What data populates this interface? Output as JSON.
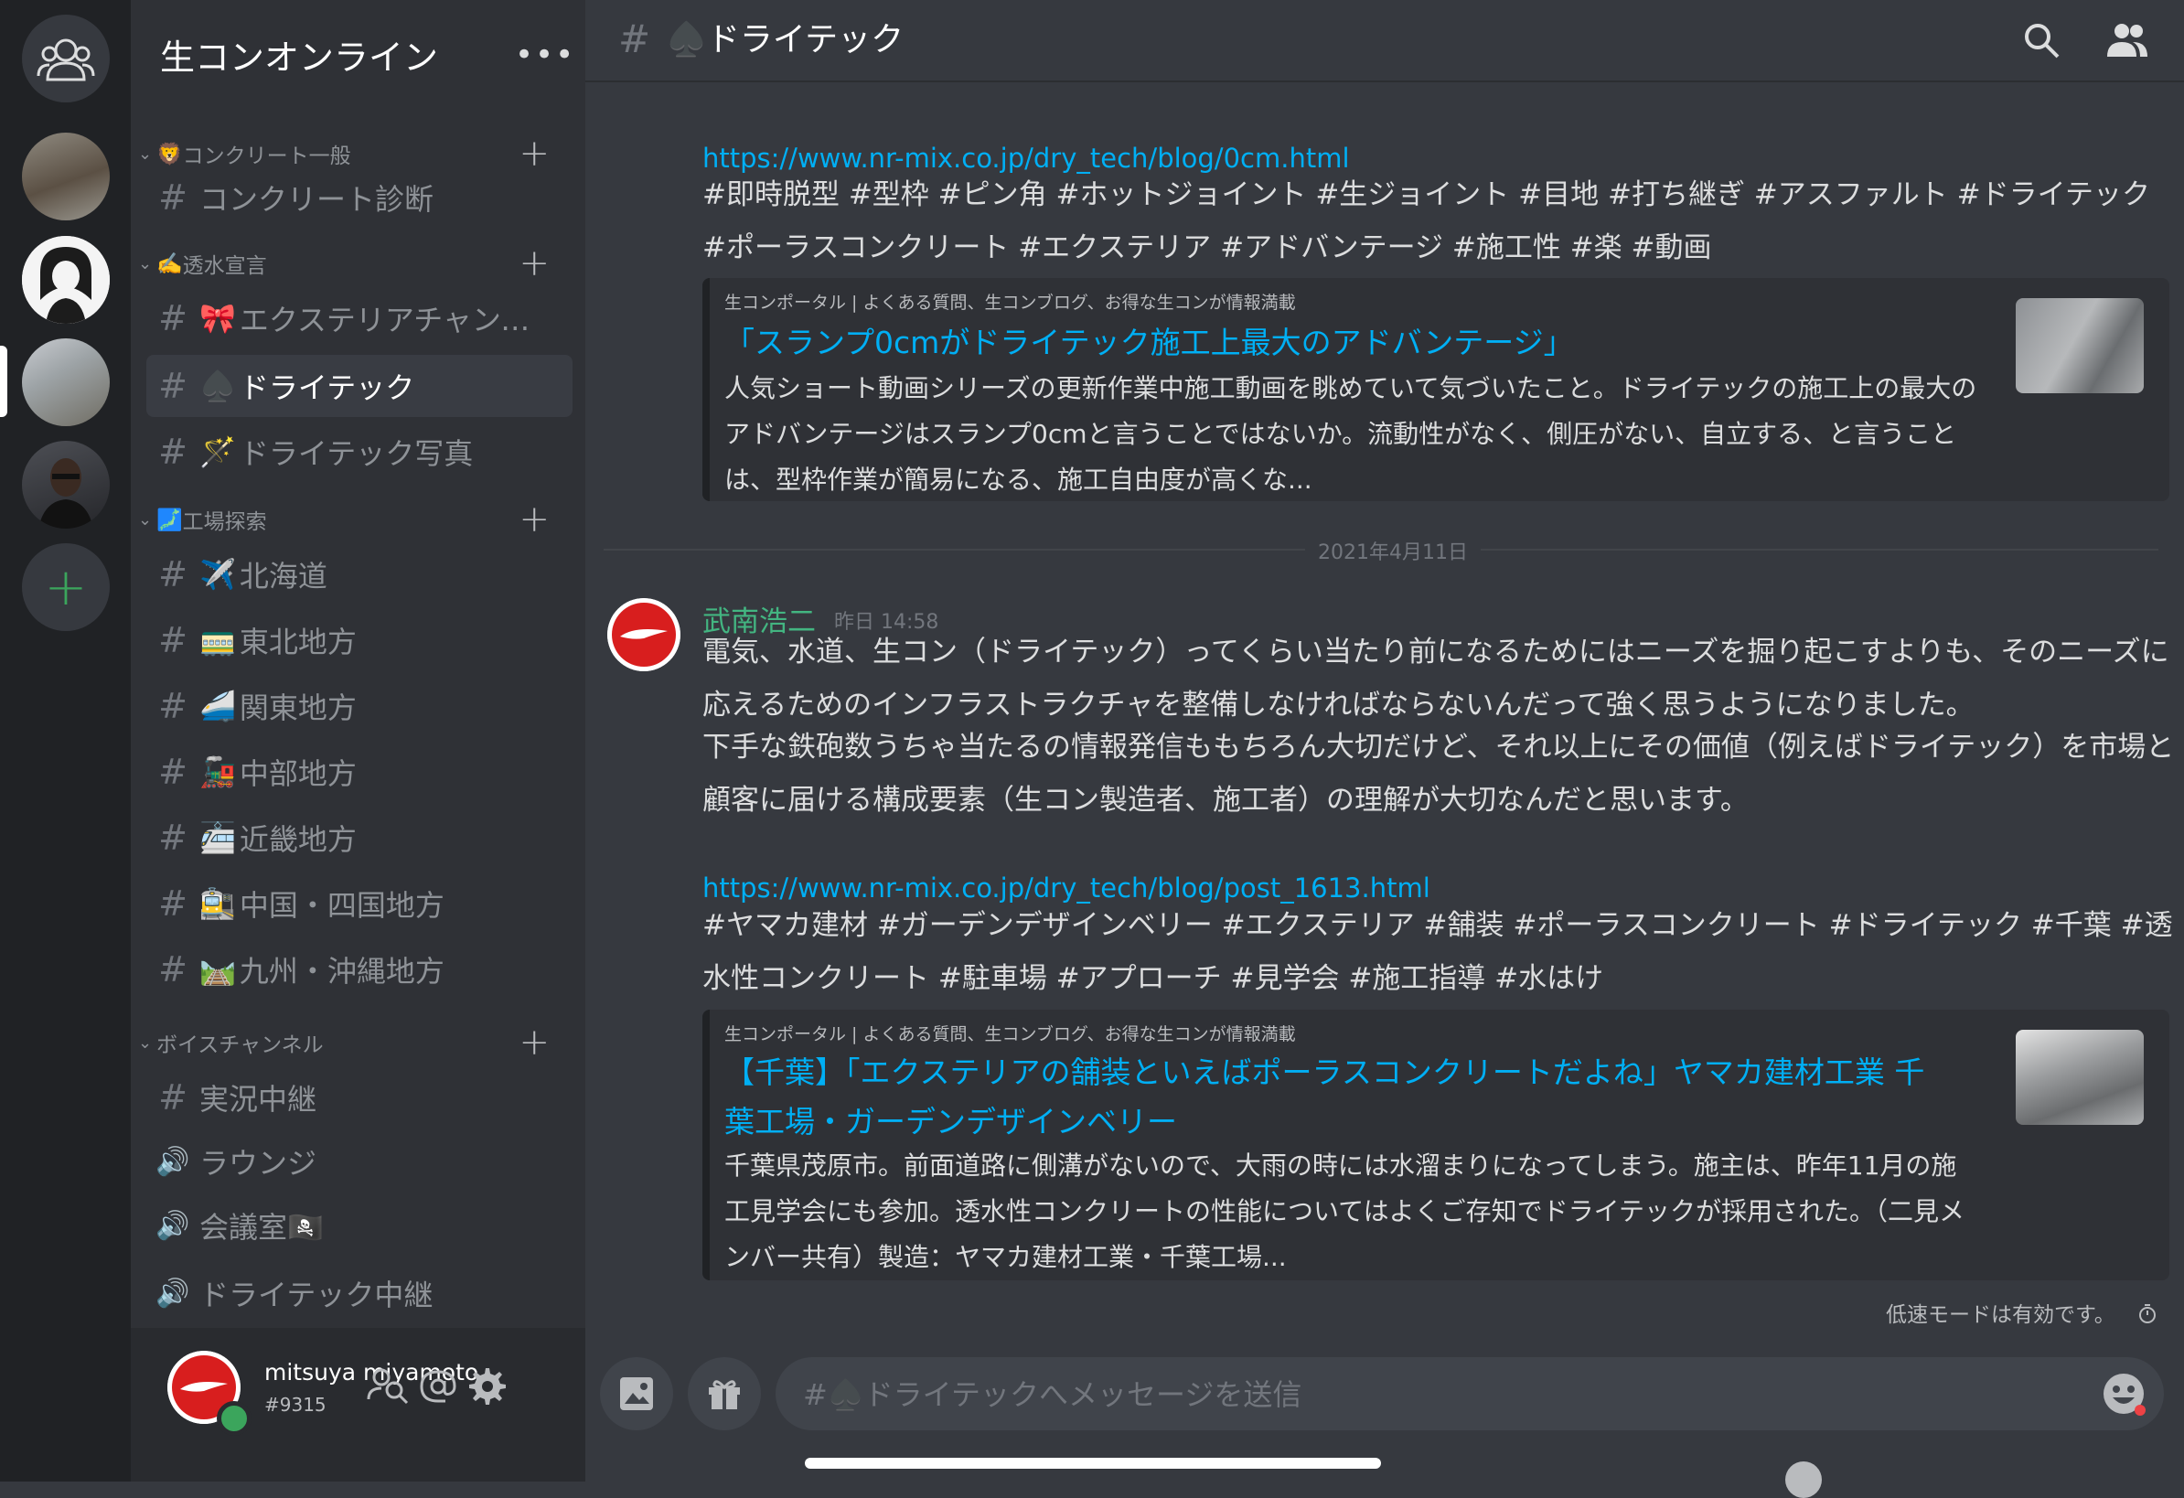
{
  "guild": {
    "name": "生コンオンライン",
    "more": "•••"
  },
  "categories": [
    {
      "emoji": "🦁",
      "name": "コンクリート一般"
    },
    {
      "emoji": "✍️",
      "name": "透水宣言"
    },
    {
      "emoji": "🗾",
      "name": "工場探索"
    },
    {
      "emoji": "",
      "name": "ボイスチャンネル"
    }
  ],
  "channels": [
    {
      "icon": "#",
      "emoji": "",
      "name": "コンクリート診断"
    },
    {
      "icon": "#",
      "emoji": "🎀",
      "name": "エクステリアチャンネル"
    },
    {
      "icon": "#",
      "emoji": "♠️",
      "name": "ドライテック"
    },
    {
      "icon": "#",
      "emoji": "🪄",
      "name": "ドライテック写真"
    },
    {
      "icon": "#",
      "emoji": "✈️",
      "name": "北海道"
    },
    {
      "icon": "#",
      "emoji": "🚃",
      "name": "東北地方"
    },
    {
      "icon": "#",
      "emoji": "🚄",
      "name": "関東地方"
    },
    {
      "icon": "#",
      "emoji": "🚂",
      "name": "中部地方"
    },
    {
      "icon": "#",
      "emoji": "🚈",
      "name": "近畿地方"
    },
    {
      "icon": "#",
      "emoji": "🚉",
      "name": "中国・四国地方"
    },
    {
      "icon": "#",
      "emoji": "🛤️",
      "name": "九州・沖縄地方"
    },
    {
      "icon": "#",
      "emoji": "",
      "name": "実況中継"
    },
    {
      "icon": "🔊",
      "emoji": "",
      "name": "ラウンジ"
    },
    {
      "icon": "🔊",
      "emoji": "",
      "name": "会議室🏴‍☠️"
    },
    {
      "icon": "🔊",
      "emoji": "",
      "name": "ドライテック中継"
    }
  ],
  "user": {
    "name": "mitsuya miyamoto",
    "tag": "#9315",
    "status_color": "#3ba55c"
  },
  "header": {
    "hash": "#",
    "title": "♠️ドライテック"
  },
  "messages": {
    "m1": {
      "link": "https://www.nr-mix.co.jp/dry_tech/blog/0cm.html",
      "text": "#即時脱型 #型枠 #ピン角 #ホットジョイント #生ジョイント #目地 #打ち継ぎ #アスファルト #ドライテック #ポーラスコンクリート #エクステリア #アドバンテージ #施工性 #楽 #動画",
      "embed": {
        "provider": "生コンポータル | よくある質問、生コンブログ、お得な生コンが情報満載",
        "title": "「スランプ0cmがドライテック施工上最大のアドバンテージ」",
        "desc": "人気ショート動画シリーズの更新作業中施工動画を眺めていて気づいたこと。ドライテックの施工上の最大のアドバンテージはスランプ0cmと言うことではないか。流動性がなく、側圧がない、自立する、と言うことは、型枠作業が簡易になる、施工自由度が高くな..."
      }
    },
    "divider": "2021年4月11日",
    "m2": {
      "author": "武南浩二",
      "time": "昨日 14:58",
      "text1": "電気、水道、生コン（ドライテック）ってくらい当たり前になるためにはニーズを掘り起こすよりも、そのニーズに応えるためのインフラストラクチャを整備しなければならないんだって強く思うようになりました。",
      "text2": "下手な鉄砲数うちゃ当たるの情報発信ももちろん大切だけど、それ以上にその価値（例えばドライテック）を市場と顧客に届ける構成要素（生コン製造者、施工者）の理解が大切なんだと思います。",
      "link": "https://www.nr-mix.co.jp/dry_tech/blog/post_1613.html",
      "tags": "#ヤマカ建材 #ガーデンデザインベリー #エクステリア #舗装 #ポーラスコンクリート #ドライテック #千葉 #透水性コンクリート #駐車場 #アプローチ #見学会 #施工指導 #水はけ",
      "embed": {
        "provider": "生コンポータル | よくある質問、生コンブログ、お得な生コンが情報満載",
        "title": "【千葉】「エクステリアの舗装といえばポーラスコンクリートだよね」ヤマカ建材工業 千葉工場・ガーデンデザインベリー",
        "desc": "千葉県茂原市。前面道路に側溝がないので、大雨の時には水溜まりになってしまう。施主は、昨年11月の施工見学会にも参加。透水性コンクリートの性能についてはよくご存知でドライテックが採用された。（二見メンバー共有）製造：ヤマカ建材工業・千葉工場..."
      }
    }
  },
  "slowmode": "低速モードは有効です。",
  "composer": {
    "placeholder": "#♠️ドライテックへメッセージを送信"
  }
}
